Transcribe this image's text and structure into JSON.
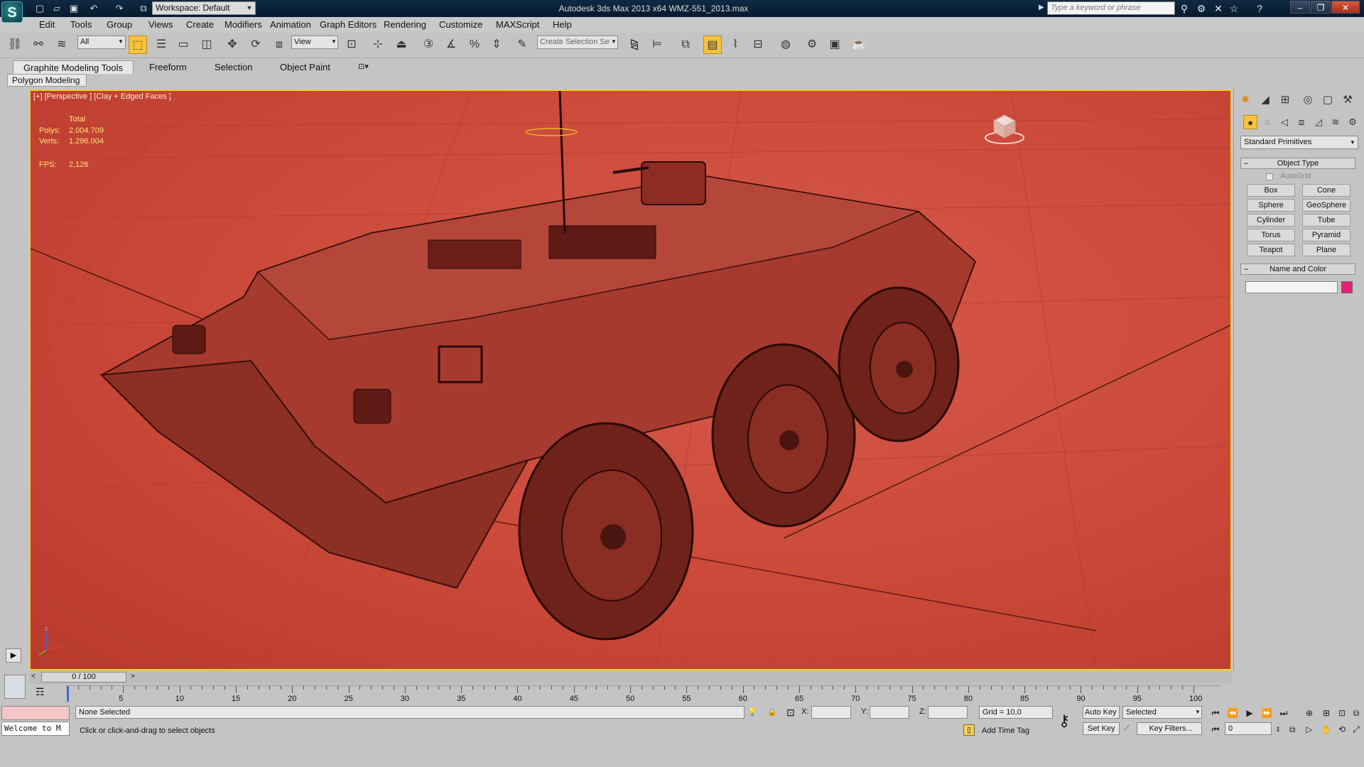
{
  "titlebar": {
    "logo_glyph": "S",
    "title": "Autodesk 3ds Max  2013 x64     WMZ-551_2013.max",
    "workspace": "Workspace: Default",
    "search_placeholder": "Type a keyword or phrase",
    "window_buttons": {
      "minimize": "–",
      "restore": "❐",
      "close": "✕"
    }
  },
  "menu": [
    "Edit",
    "Tools",
    "Group",
    "Views",
    "Create",
    "Modifiers",
    "Animation",
    "Graph Editors",
    "Rendering",
    "Customize",
    "MAXScript",
    "Help"
  ],
  "toolbar": {
    "filter_value": "All",
    "refcoord_value": "View",
    "selection_set_placeholder": "Create Selection Se"
  },
  "ribbon": {
    "tabs": [
      "Graphite Modeling Tools",
      "Freeform",
      "Selection",
      "Object Paint"
    ],
    "active_tab": "Graphite Modeling Tools",
    "panel_label": "Polygon Modeling"
  },
  "viewport": {
    "label": "[+] [Perspective ] [Clay + Edged Faces ]",
    "stats": {
      "total_label": "Total",
      "polys_label": "Polys:",
      "polys": "2.004.709",
      "verts_label": "Verts:",
      "verts": "1.296.004",
      "fps_label": "FPS:",
      "fps": "2,126"
    },
    "background_color": "#cc4a3a",
    "active_border_color": "#f0d020",
    "axis": {
      "x": "x",
      "y": "y",
      "z": "z"
    }
  },
  "command_panel": {
    "category": "Standard Primitives",
    "object_type_title": "Object Type",
    "autogrid": "AutoGrid",
    "primitives": [
      "Box",
      "Cone",
      "Sphere",
      "GeoSphere",
      "Cylinder",
      "Tube",
      "Torus",
      "Pyramid",
      "Teapot",
      "Plane"
    ],
    "name_color_title": "Name and Color",
    "swatch_color": "#e6207a"
  },
  "timeline": {
    "frame": "0 / 100",
    "ticks": [
      "5",
      "10",
      "15",
      "20",
      "25",
      "30",
      "35",
      "40",
      "45",
      "50",
      "55",
      "60",
      "65",
      "70",
      "75",
      "80",
      "85",
      "90",
      "95",
      "100"
    ]
  },
  "status": {
    "selection": "None Selected",
    "prompt": "Click or click-and-drag to select objects",
    "x_label": "X:",
    "y_label": "Y:",
    "z_label": "Z:",
    "grid": "Grid = 10,0",
    "add_time_tag": "Add Time Tag",
    "auto_key": "Auto Key",
    "set_key": "Set Key",
    "key_mode": "Selected",
    "key_filters": "Key Filters...",
    "frame_value": "0",
    "listener_text": "Welcome to M"
  }
}
